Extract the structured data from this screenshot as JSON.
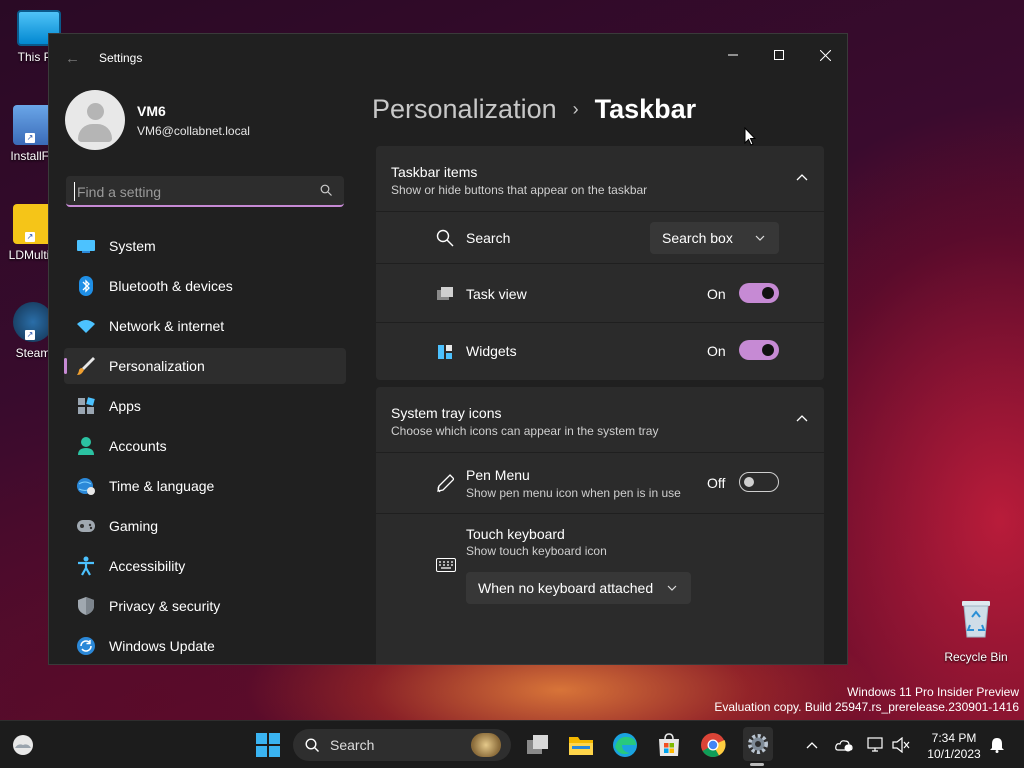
{
  "desktop": {
    "icons": [
      {
        "label": "This PC"
      },
      {
        "label": "InstallFo"
      },
      {
        "label": "LDMultiP"
      },
      {
        "label": "Steam"
      }
    ],
    "recycle_bin": "Recycle Bin",
    "watermark": {
      "line1": "Windows 11 Pro Insider Preview",
      "line2": "Evaluation copy. Build 25947.rs_prerelease.230901-1416"
    }
  },
  "window": {
    "title": "Settings",
    "accent_color": "#c68ad4",
    "profile": {
      "name": "VM6",
      "email": "VM6@collabnet.local"
    },
    "search": {
      "placeholder": "Find a setting"
    },
    "nav": [
      {
        "label": "System",
        "icon": "monitor-icon"
      },
      {
        "label": "Bluetooth & devices",
        "icon": "bluetooth-icon"
      },
      {
        "label": "Network & internet",
        "icon": "wifi-icon"
      },
      {
        "label": "Personalization",
        "icon": "brush-icon",
        "active": true
      },
      {
        "label": "Apps",
        "icon": "apps-icon"
      },
      {
        "label": "Accounts",
        "icon": "person-icon"
      },
      {
        "label": "Time & language",
        "icon": "globe-clock-icon"
      },
      {
        "label": "Gaming",
        "icon": "gamepad-icon"
      },
      {
        "label": "Accessibility",
        "icon": "accessibility-icon"
      },
      {
        "label": "Privacy & security",
        "icon": "shield-icon"
      },
      {
        "label": "Windows Update",
        "icon": "update-icon"
      }
    ],
    "breadcrumb": {
      "parent": "Personalization",
      "separator": "›",
      "current": "Taskbar"
    },
    "taskbar_items": {
      "title": "Taskbar items",
      "subtitle": "Show or hide buttons that appear on the taskbar",
      "search": {
        "label": "Search",
        "value": "Search box"
      },
      "task_view": {
        "label": "Task view",
        "state": "On"
      },
      "widgets": {
        "label": "Widgets",
        "state": "On"
      }
    },
    "system_tray": {
      "title": "System tray icons",
      "subtitle": "Choose which icons can appear in the system tray",
      "pen_menu": {
        "label": "Pen Menu",
        "subtitle": "Show pen menu icon when pen is in use",
        "state": "Off"
      },
      "touch_keyboard": {
        "label": "Touch keyboard",
        "subtitle": "Show touch keyboard icon",
        "value": "When no keyboard attached"
      }
    }
  },
  "taskbar": {
    "search_label": "Search",
    "time": "7:34 PM",
    "date": "10/1/2023"
  }
}
